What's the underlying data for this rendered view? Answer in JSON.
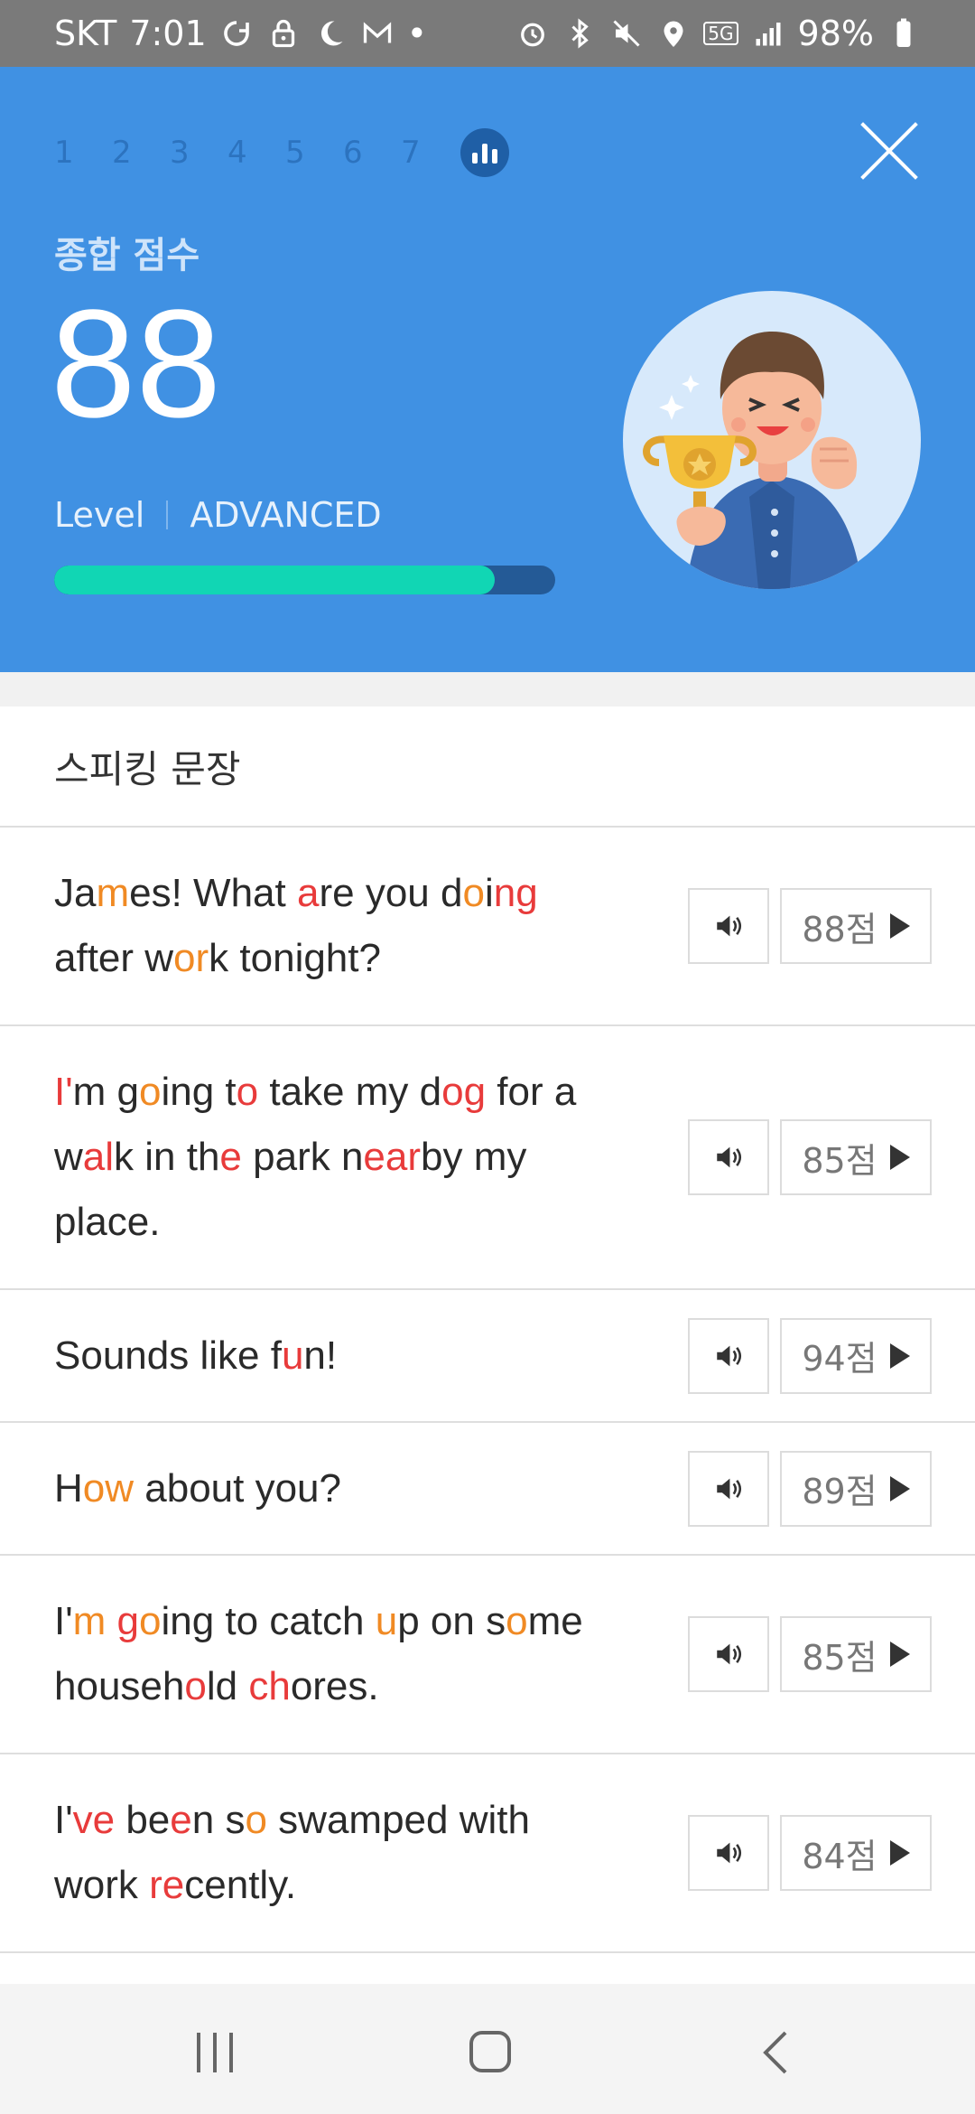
{
  "status_bar": {
    "carrier": "SKT",
    "time": "7:01",
    "dot": "•",
    "network": "5G",
    "battery": "98%"
  },
  "header": {
    "steps": [
      "1",
      "2",
      "3",
      "4",
      "5",
      "6",
      "7"
    ],
    "score_title": "종합 점수",
    "score": "88",
    "level_label": "Level",
    "level_value": "ADVANCED",
    "progress": 0.88,
    "colors": {
      "background": "#4091e3",
      "progress_fill": "#11d6b4",
      "progress_track": "#245a96"
    }
  },
  "section": {
    "title": "스피킹 문장"
  },
  "sentences": [
    {
      "segments": [
        {
          "t": "Ja"
        },
        {
          "t": "m",
          "c": "o"
        },
        {
          "t": "es! What "
        },
        {
          "t": "a",
          "c": "r"
        },
        {
          "t": "re you d"
        },
        {
          "t": "o",
          "c": "o"
        },
        {
          "t": "i"
        },
        {
          "t": "ng",
          "c": "r"
        },
        {
          "t": " after w"
        },
        {
          "t": "or",
          "c": "o"
        },
        {
          "t": "k tonight?"
        }
      ],
      "score": "88점"
    },
    {
      "segments": [
        {
          "t": "I'",
          "c": "r"
        },
        {
          "t": "m g"
        },
        {
          "t": "o",
          "c": "o"
        },
        {
          "t": "ing t"
        },
        {
          "t": "o",
          "c": "r"
        },
        {
          "t": " take my d"
        },
        {
          "t": "og",
          "c": "r"
        },
        {
          "t": " for a w"
        },
        {
          "t": "al",
          "c": "r"
        },
        {
          "t": "k in th"
        },
        {
          "t": "e",
          "c": "r"
        },
        {
          "t": " park n"
        },
        {
          "t": "ear",
          "c": "r"
        },
        {
          "t": "by my place."
        }
      ],
      "score": "85점"
    },
    {
      "segments": [
        {
          "t": "Sounds like f"
        },
        {
          "t": "u",
          "c": "r"
        },
        {
          "t": "n!"
        }
      ],
      "score": "94점"
    },
    {
      "segments": [
        {
          "t": "H"
        },
        {
          "t": "ow",
          "c": "o"
        },
        {
          "t": " about you?"
        }
      ],
      "score": "89점"
    },
    {
      "segments": [
        {
          "t": "I'"
        },
        {
          "t": "m",
          "c": "o"
        },
        {
          "t": " "
        },
        {
          "t": "g",
          "c": "r"
        },
        {
          "t": "o",
          "c": "o"
        },
        {
          "t": "ing to catch "
        },
        {
          "t": "u",
          "c": "o"
        },
        {
          "t": "p on s"
        },
        {
          "t": "o",
          "c": "o"
        },
        {
          "t": "me househ"
        },
        {
          "t": "o",
          "c": "r"
        },
        {
          "t": "ld "
        },
        {
          "t": "ch",
          "c": "r"
        },
        {
          "t": "ores."
        }
      ],
      "score": "85점"
    },
    {
      "segments": [
        {
          "t": "I'"
        },
        {
          "t": "ve",
          "c": "r"
        },
        {
          "t": " be"
        },
        {
          "t": "e",
          "c": "r"
        },
        {
          "t": "n s"
        },
        {
          "t": "o",
          "c": "o"
        },
        {
          "t": " swamped with work "
        },
        {
          "t": "re",
          "c": "r"
        },
        {
          "t": "cently."
        }
      ],
      "score": "84점"
    }
  ],
  "icons": {
    "close": "close-icon",
    "chart": "bar-chart-icon",
    "speaker": "speaker-icon",
    "play": "play-icon",
    "trophy_avatar": "trophy-person-illustration"
  }
}
